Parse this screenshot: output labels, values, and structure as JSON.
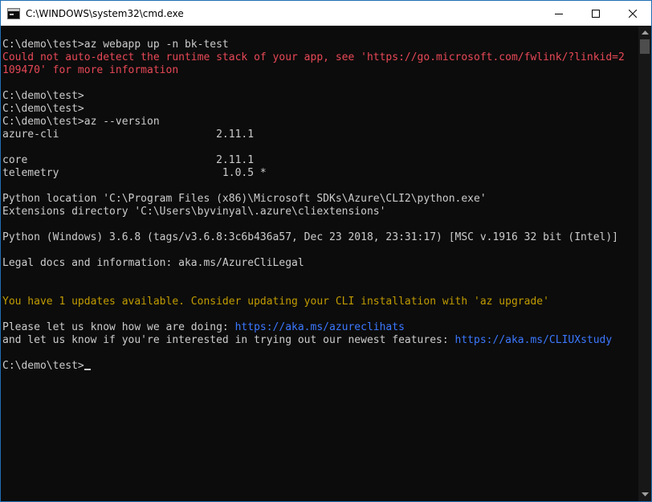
{
  "window": {
    "title": "C:\\WINDOWS\\system32\\cmd.exe",
    "app_icon": "cmd-console-icon",
    "controls": {
      "minimize_icon": "minimize-icon",
      "maximize_icon": "maximize-icon",
      "close_icon": "close-icon"
    }
  },
  "colors": {
    "background": "#0c0c0c",
    "text": "#cccccc",
    "error": "#e74856",
    "warning": "#c19c00",
    "link": "#3b78ff",
    "window_border": "#1f6fb5"
  },
  "console": {
    "lines": [
      {
        "segments": [
          {
            "text": "C:\\demo\\test>az webapp up -n bk-test",
            "style": "normal"
          }
        ]
      },
      {
        "segments": [
          {
            "text": "Could not auto-detect the runtime stack of your app, see 'https://go.microsoft.com/fwlink/?linkid=2",
            "style": "error"
          }
        ]
      },
      {
        "segments": [
          {
            "text": "109470' for more information",
            "style": "error"
          }
        ]
      },
      {
        "segments": []
      },
      {
        "segments": [
          {
            "text": "C:\\demo\\test>",
            "style": "normal"
          }
        ]
      },
      {
        "segments": [
          {
            "text": "C:\\demo\\test>",
            "style": "normal"
          }
        ]
      },
      {
        "segments": [
          {
            "text": "C:\\demo\\test>az --version",
            "style": "normal"
          }
        ]
      },
      {
        "segments": [
          {
            "text": "azure-cli                         2.11.1",
            "style": "normal"
          }
        ]
      },
      {
        "segments": []
      },
      {
        "segments": [
          {
            "text": "core                              2.11.1",
            "style": "normal"
          }
        ]
      },
      {
        "segments": [
          {
            "text": "telemetry                          1.0.5 *",
            "style": "normal"
          }
        ]
      },
      {
        "segments": []
      },
      {
        "segments": [
          {
            "text": "Python location 'C:\\Program Files (x86)\\Microsoft SDKs\\Azure\\CLI2\\python.exe'",
            "style": "normal"
          }
        ]
      },
      {
        "segments": [
          {
            "text": "Extensions directory 'C:\\Users\\byvinyal\\.azure\\cliextensions'",
            "style": "normal"
          }
        ]
      },
      {
        "segments": []
      },
      {
        "segments": [
          {
            "text": "Python (Windows) 3.6.8 (tags/v3.6.8:3c6b436a57, Dec 23 2018, 23:31:17) [MSC v.1916 32 bit (Intel)]",
            "style": "normal"
          }
        ]
      },
      {
        "segments": []
      },
      {
        "segments": [
          {
            "text": "Legal docs and information: aka.ms/AzureCliLegal",
            "style": "normal"
          }
        ]
      },
      {
        "segments": []
      },
      {
        "segments": []
      },
      {
        "segments": [
          {
            "text": "You have 1 updates available. Consider updating your CLI installation with 'az upgrade'",
            "style": "warn"
          }
        ]
      },
      {
        "segments": []
      },
      {
        "segments": [
          {
            "text": "Please let us know how we are doing: ",
            "style": "normal"
          },
          {
            "text": "https://aka.ms/azureclihats",
            "style": "link"
          }
        ]
      },
      {
        "segments": [
          {
            "text": "and let us know if you're interested in trying out our newest features: ",
            "style": "normal"
          },
          {
            "text": "https://aka.ms/CLIUXstudy",
            "style": "link"
          }
        ]
      },
      {
        "segments": []
      },
      {
        "segments": [
          {
            "text": "C:\\demo\\test>",
            "style": "normal"
          }
        ],
        "cursor": true
      }
    ]
  },
  "scrollbar": {
    "up_icon": "scroll-up-arrow-icon",
    "down_icon": "scroll-down-arrow-icon",
    "position_fraction": 0.0
  }
}
